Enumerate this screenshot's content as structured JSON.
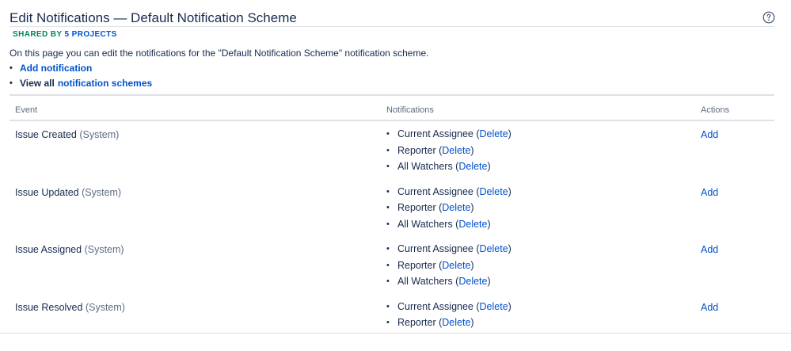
{
  "page": {
    "title": "Edit Notifications — Default Notification Scheme",
    "shared_label": "SHARED BY",
    "shared_link": "5 PROJECTS",
    "description": "On this page you can edit the notifications for the \"Default Notification Scheme\" notification scheme.",
    "ops": {
      "add_notification": "Add notification",
      "view_all_prefix": "View all",
      "view_all_link": "notification schemes"
    }
  },
  "icons": {
    "help": "help-circle-icon"
  },
  "table": {
    "headers": {
      "event": "Event",
      "notifications": "Notifications",
      "actions": "Actions"
    },
    "rows": [
      {
        "event": "Issue Created",
        "event_suffix": "(System)",
        "action": "Add",
        "notifications": [
          {
            "name": "Current Assignee",
            "delete": "Delete"
          },
          {
            "name": "Reporter",
            "delete": "Delete"
          },
          {
            "name": "All Watchers",
            "delete": "Delete"
          }
        ]
      },
      {
        "event": "Issue Updated",
        "event_suffix": "(System)",
        "action": "Add",
        "notifications": [
          {
            "name": "Current Assignee",
            "delete": "Delete"
          },
          {
            "name": "Reporter",
            "delete": "Delete"
          },
          {
            "name": "All Watchers",
            "delete": "Delete"
          }
        ]
      },
      {
        "event": "Issue Assigned",
        "event_suffix": "(System)",
        "action": "Add",
        "notifications": [
          {
            "name": "Current Assignee",
            "delete": "Delete"
          },
          {
            "name": "Reporter",
            "delete": "Delete"
          },
          {
            "name": "All Watchers",
            "delete": "Delete"
          }
        ]
      },
      {
        "event": "Issue Resolved",
        "event_suffix": "(System)",
        "action": "Add",
        "notifications": [
          {
            "name": "Current Assignee",
            "delete": "Delete"
          },
          {
            "name": "Reporter",
            "delete": "Delete"
          }
        ]
      }
    ]
  },
  "colors": {
    "link": "#0052cc",
    "shared_label": "#00875a",
    "text": "#172b4d",
    "muted": "#5e6c84",
    "rule": "#dfe1e6"
  }
}
